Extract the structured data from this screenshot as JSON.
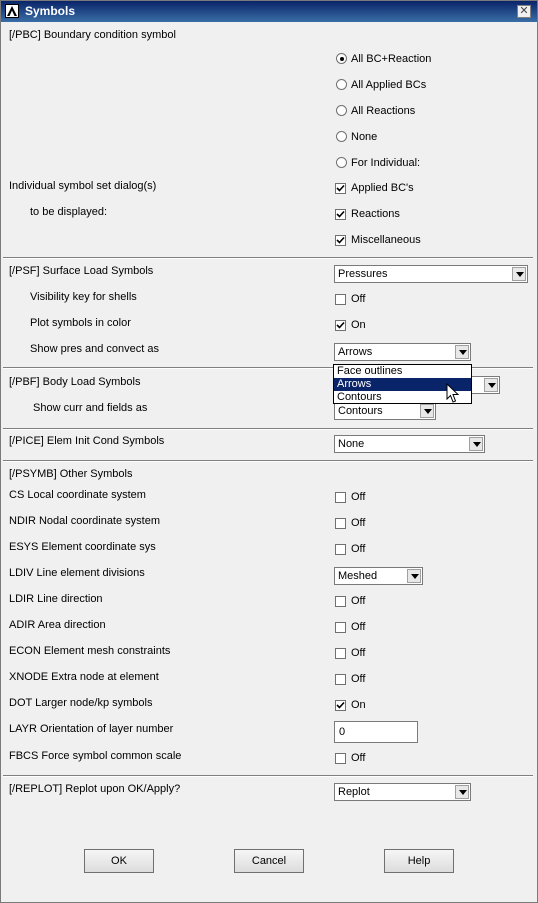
{
  "window": {
    "title": "Symbols",
    "close_glyph": "✕"
  },
  "pbc": {
    "heading": "[/PBC] Boundary condition symbol",
    "radios": [
      {
        "label": "All BC+Reaction",
        "checked": true
      },
      {
        "label": "All Applied BCs",
        "checked": false
      },
      {
        "label": "All Reactions",
        "checked": false
      },
      {
        "label": "None",
        "checked": false
      },
      {
        "label": "For Individual:",
        "checked": false
      }
    ],
    "individual_label_1": "Individual symbol set dialog(s)",
    "individual_label_2": "to be displayed:",
    "checks": [
      {
        "label": "Applied BC's",
        "checked": true
      },
      {
        "label": "Reactions",
        "checked": true
      },
      {
        "label": "Miscellaneous",
        "checked": true
      }
    ]
  },
  "psf": {
    "heading": "[/PSF]  Surface Load Symbols",
    "surface_value": "Pressures",
    "visibility_label": "Visibility key for shells",
    "visibility_check": "Off",
    "color_label": "Plot symbols in color",
    "color_check": "On",
    "pres_label": "Show pres and convect as",
    "pres_value": "Arrows",
    "pres_options": [
      "Face outlines",
      "Arrows",
      "Contours"
    ]
  },
  "pbf": {
    "heading": "[/PBF]  Body Load Symbols",
    "curr_label": "Show curr and fields as",
    "curr_value": "Contours"
  },
  "pice": {
    "heading": "[/PICE] Elem Init Cond Symbols",
    "value": "None"
  },
  "psymb": {
    "heading": "[/PSYMB] Other Symbols",
    "rows": [
      {
        "label": "CS   Local coordinate system",
        "state": "Off",
        "checked": false
      },
      {
        "label": "NDIR Nodal coordinate system",
        "state": "Off",
        "checked": false
      },
      {
        "label": "ESYS Element coordinate sys",
        "state": "Off",
        "checked": false
      },
      {
        "label": "LDIV  Line element divisions",
        "combo": "Meshed"
      },
      {
        "label": "LDIR Line direction",
        "state": "Off",
        "checked": false
      },
      {
        "label": "ADIR Area direction",
        "state": "Off",
        "checked": false
      },
      {
        "label": "ECON Element mesh constraints",
        "state": "Off",
        "checked": false
      },
      {
        "label": "XNODE Extra node at element",
        "state": "Off",
        "checked": false
      },
      {
        "label": "DOT  Larger node/kp symbols",
        "state": "On",
        "checked": true
      },
      {
        "label": "LAYR Orientation of layer number",
        "text": "0"
      },
      {
        "label": "FBCS Force symbol common scale",
        "state": "Off",
        "checked": false
      }
    ]
  },
  "replot": {
    "heading": "[/REPLOT] Replot upon OK/Apply?",
    "value": "Replot"
  },
  "buttons": {
    "ok": "OK",
    "cancel": "Cancel",
    "help": "Help"
  }
}
